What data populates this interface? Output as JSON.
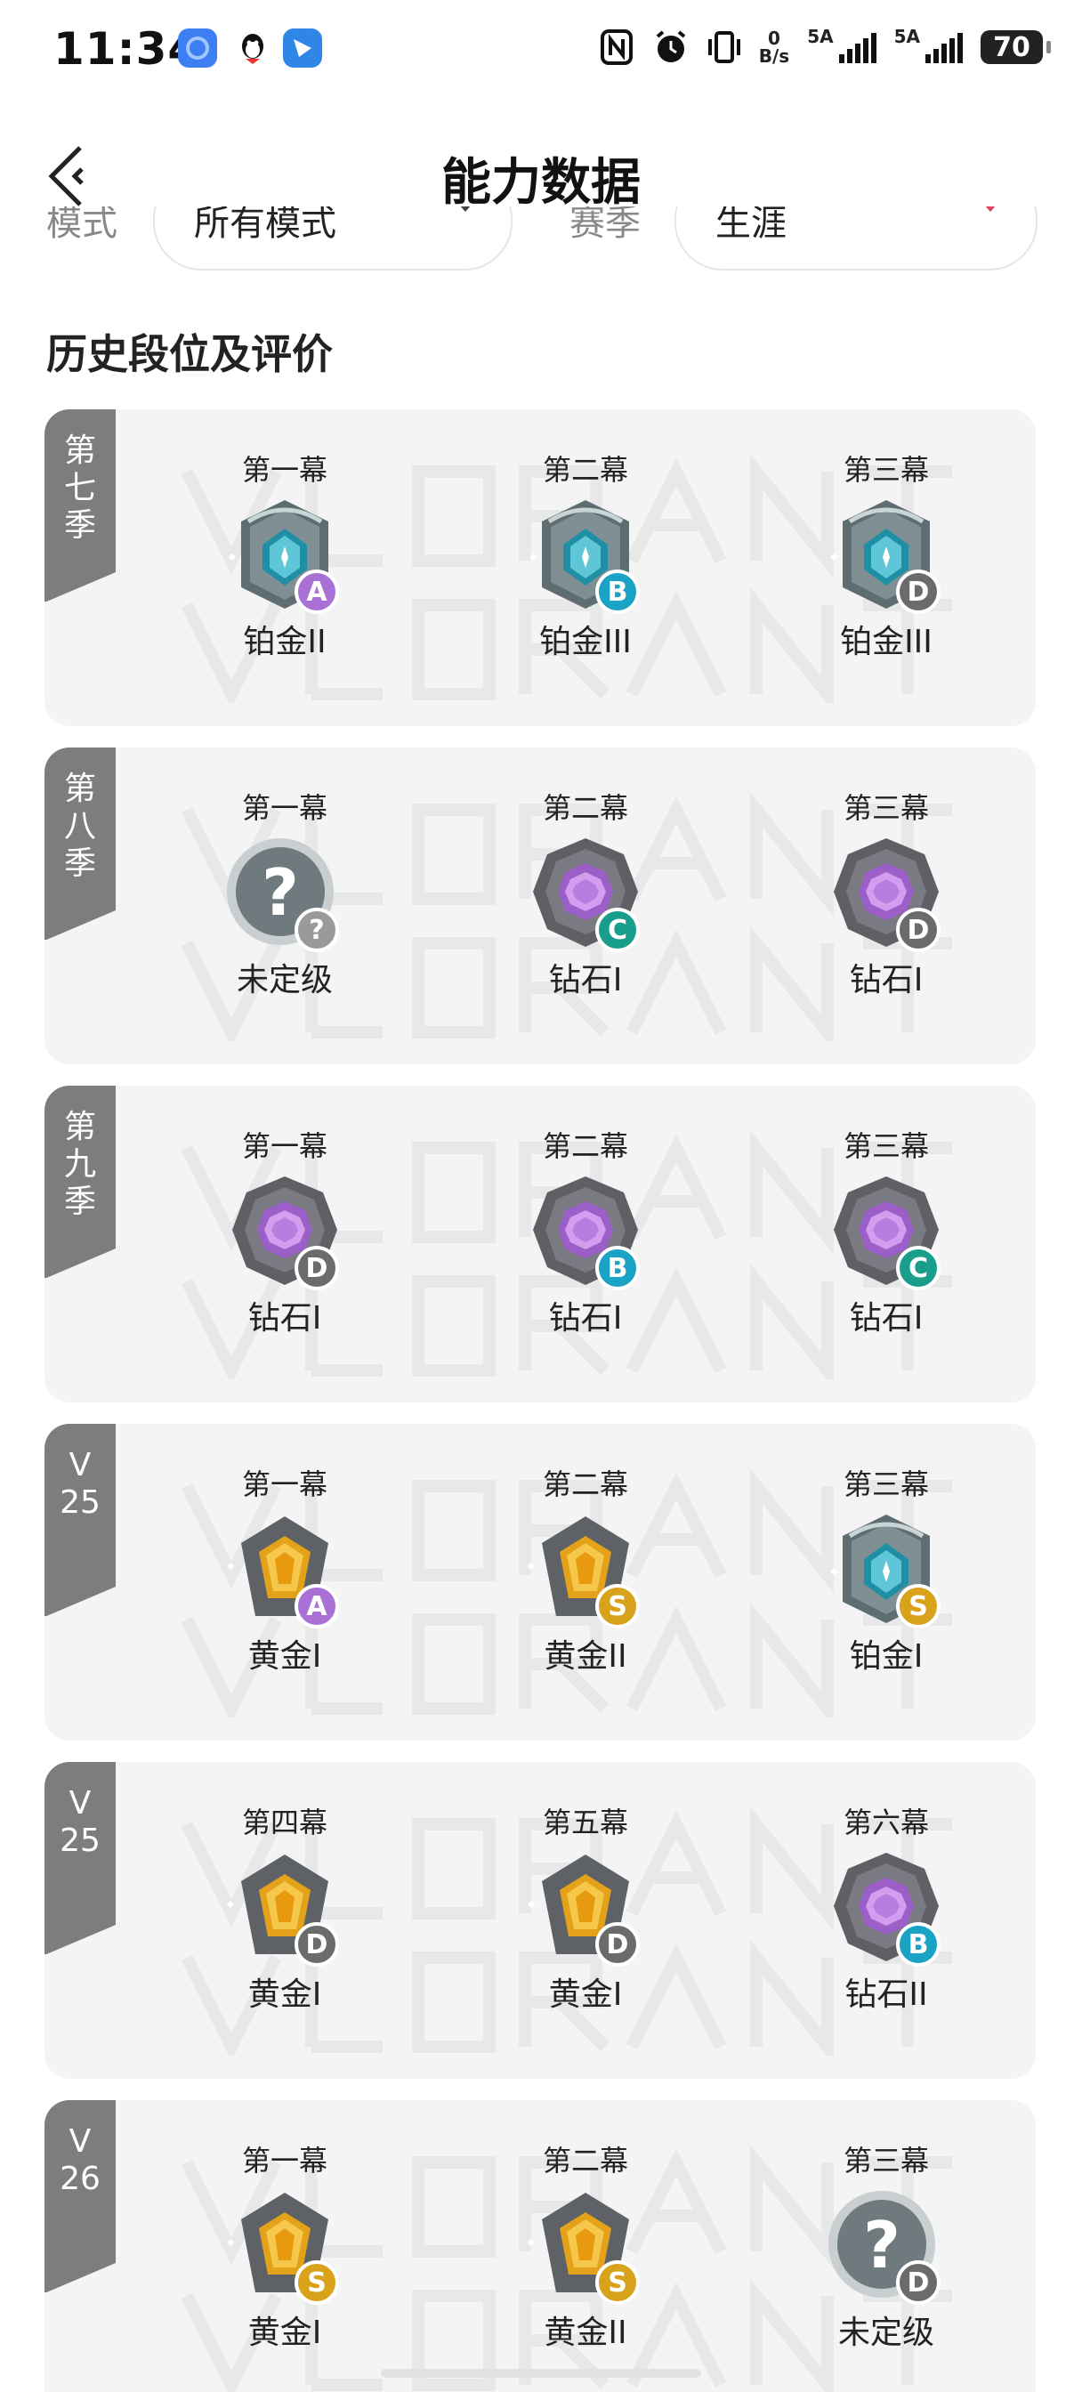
{
  "status_bar": {
    "time": "11:34",
    "net_speed_top": "0",
    "net_speed_bottom": "B/s",
    "sim1_label": "5A",
    "sim2_label": "5A",
    "battery": "70"
  },
  "header": {
    "title": "能力数据"
  },
  "filters": {
    "mode_label": "模式",
    "mode_value": "所有模式",
    "season_label": "赛季",
    "season_value": "生涯"
  },
  "section_title": "历史段位及评价",
  "colors": {
    "grade_A": "#a970d6",
    "grade_B": "#1aa3c4",
    "grade_C": "#1a9e8c",
    "grade_D": "#6b6b6b",
    "grade_S": "#d9a21b",
    "grade_unknown": "#9a9a9a"
  },
  "seasons": [
    {
      "label": "第\n七\n季",
      "acts": [
        {
          "act": "第一幕",
          "rank": "铂金II",
          "tier": "platinum",
          "grade": "A"
        },
        {
          "act": "第二幕",
          "rank": "铂金III",
          "tier": "platinum",
          "grade": "B"
        },
        {
          "act": "第三幕",
          "rank": "铂金III",
          "tier": "platinum",
          "grade": "D"
        }
      ]
    },
    {
      "label": "第\n八\n季",
      "acts": [
        {
          "act": "第一幕",
          "rank": "未定级",
          "tier": "unranked",
          "grade": "?"
        },
        {
          "act": "第二幕",
          "rank": "钻石I",
          "tier": "diamond",
          "grade": "C"
        },
        {
          "act": "第三幕",
          "rank": "钻石I",
          "tier": "diamond",
          "grade": "D"
        }
      ]
    },
    {
      "label": "第\n九\n季",
      "acts": [
        {
          "act": "第一幕",
          "rank": "钻石I",
          "tier": "diamond",
          "grade": "D"
        },
        {
          "act": "第二幕",
          "rank": "钻石I",
          "tier": "diamond",
          "grade": "B"
        },
        {
          "act": "第三幕",
          "rank": "钻石I",
          "tier": "diamond",
          "grade": "C"
        }
      ]
    },
    {
      "label": "V\n25",
      "acts": [
        {
          "act": "第一幕",
          "rank": "黄金I",
          "tier": "gold",
          "grade": "A"
        },
        {
          "act": "第二幕",
          "rank": "黄金II",
          "tier": "gold",
          "grade": "S"
        },
        {
          "act": "第三幕",
          "rank": "铂金I",
          "tier": "platinum",
          "grade": "S"
        }
      ]
    },
    {
      "label": "V\n25",
      "acts": [
        {
          "act": "第四幕",
          "rank": "黄金I",
          "tier": "gold",
          "grade": "D"
        },
        {
          "act": "第五幕",
          "rank": "黄金I",
          "tier": "gold",
          "grade": "D"
        },
        {
          "act": "第六幕",
          "rank": "钻石II",
          "tier": "diamond",
          "grade": "B"
        }
      ]
    },
    {
      "label": "V\n26",
      "acts": [
        {
          "act": "第一幕",
          "rank": "黄金I",
          "tier": "gold",
          "grade": "S"
        },
        {
          "act": "第二幕",
          "rank": "黄金II",
          "tier": "gold",
          "grade": "S"
        },
        {
          "act": "第三幕",
          "rank": "未定级",
          "tier": "unranked",
          "grade": "D"
        }
      ]
    }
  ]
}
